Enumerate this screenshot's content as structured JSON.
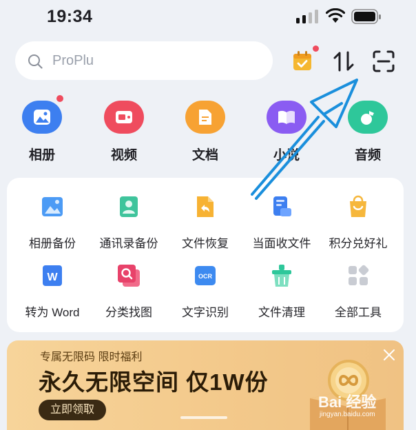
{
  "status_bar": {
    "time": "19:34"
  },
  "search": {
    "text": "ProPlu"
  },
  "categories": [
    {
      "label": "相册",
      "color": "#3d7ff0"
    },
    {
      "label": "视频",
      "color": "#ef4c5e"
    },
    {
      "label": "文档",
      "color": "#f7a233"
    },
    {
      "label": "小说",
      "color": "#8a5cf2"
    },
    {
      "label": "音频",
      "color": "#2ec79a"
    }
  ],
  "tools": [
    {
      "label": "相册备份"
    },
    {
      "label": "通讯录备份"
    },
    {
      "label": "文件恢复"
    },
    {
      "label": "当面收文件"
    },
    {
      "label": "积分兑好礼"
    },
    {
      "label": "转为 Word"
    },
    {
      "label": "分类找图"
    },
    {
      "label": "文字识别"
    },
    {
      "label": "文件清理"
    },
    {
      "label": "全部工具"
    }
  ],
  "banner": {
    "subtitle": "专属无限码 限时福利",
    "title": "永久无限空间 仅1W份",
    "button": "立即领取"
  },
  "watermark": {
    "text": "Bai 经验",
    "url": "jingyan.baidu.com"
  },
  "ocr_badge": "OCR",
  "word_badge": "W",
  "colors": {
    "background": "#eef1f6",
    "arrow": "#1a8fdc"
  }
}
